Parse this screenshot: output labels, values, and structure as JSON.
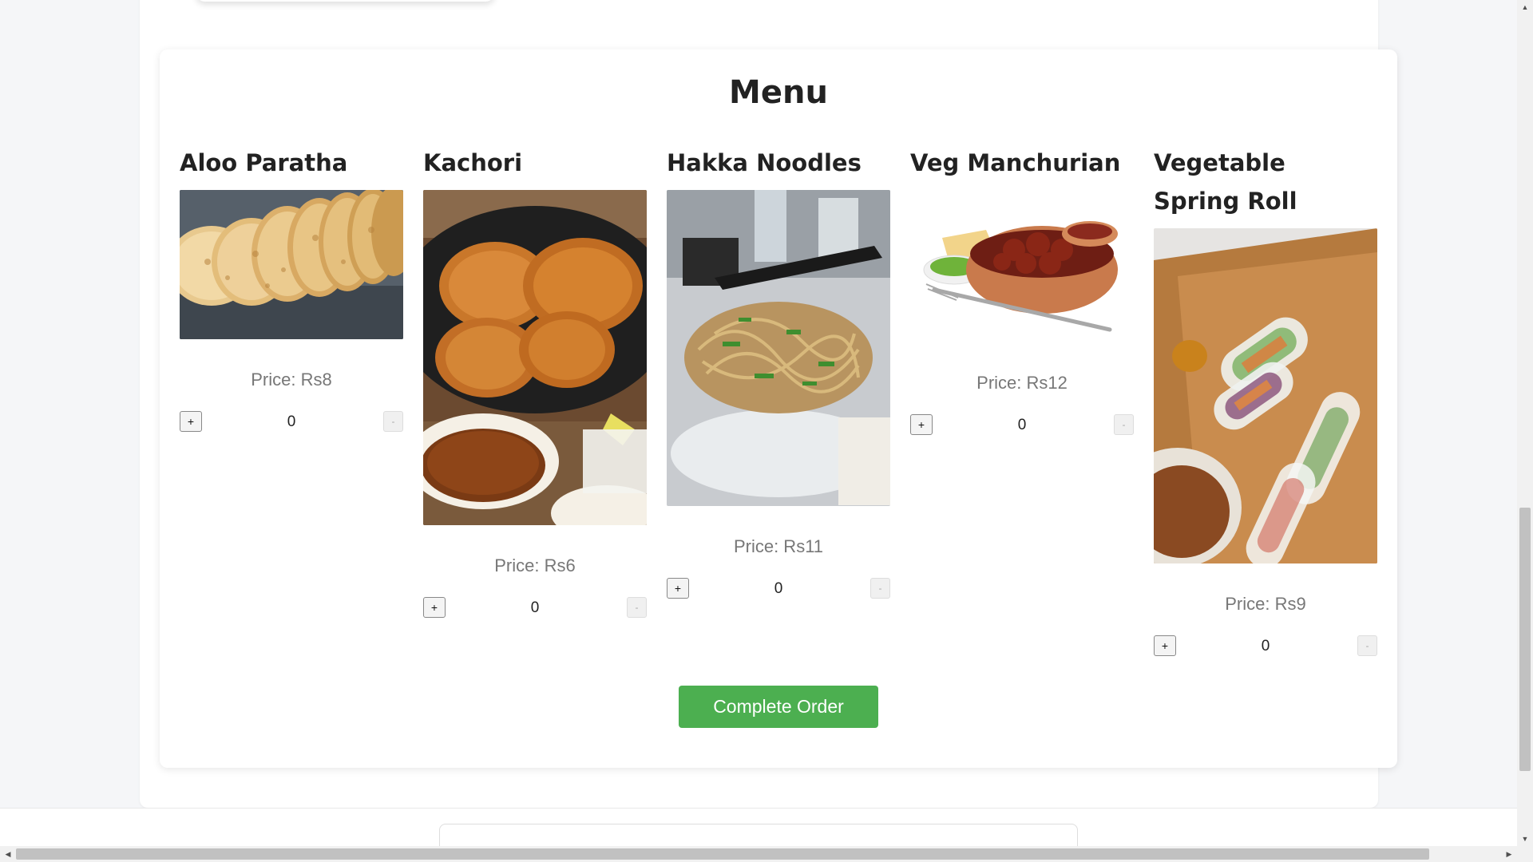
{
  "menu": {
    "title": "Menu",
    "items": [
      {
        "name": "Aloo Paratha",
        "price": "Price: Rs8",
        "quantity": "0",
        "image": "aloo-paratha-photo"
      },
      {
        "name": "Kachori",
        "price": "Price: Rs6",
        "quantity": "0",
        "image": "kachori-photo"
      },
      {
        "name": "Hakka Noodles",
        "price": "Price: Rs11",
        "quantity": "0",
        "image": "hakka-noodles-photo"
      },
      {
        "name": "Veg Manchurian",
        "price": "Price: Rs12",
        "quantity": "0",
        "image": "veg-manchurian-photo"
      },
      {
        "name": "Vegetable Spring Roll",
        "price": "Price: Rs9",
        "quantity": "0",
        "image": "spring-roll-photo"
      }
    ],
    "plus_label": "+",
    "minus_label": "-",
    "complete_label": "Complete Order"
  },
  "colors": {
    "accent": "#4caf50",
    "price_text": "#777777",
    "heading_text": "#222222"
  },
  "scrollbars": {
    "up_arrow": "▲",
    "down_arrow": "▼",
    "left_arrow": "◀",
    "right_arrow": "▶"
  }
}
